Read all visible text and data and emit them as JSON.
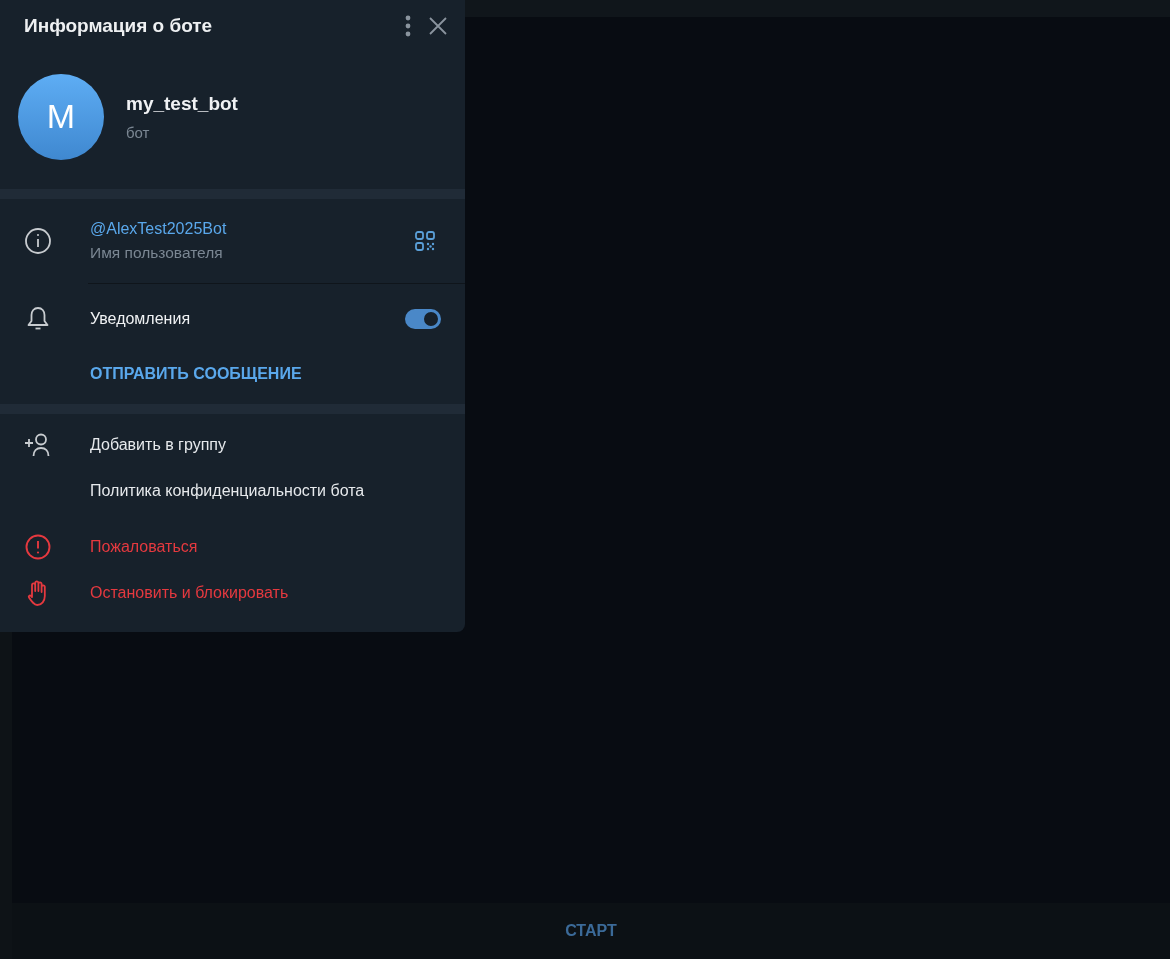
{
  "panel": {
    "title": "Информация о боте",
    "profile": {
      "avatar_letter": "M",
      "name": "my_test_bot",
      "status": "бот"
    },
    "username": {
      "value": "@AlexTest2025Bot",
      "label": "Имя пользователя"
    },
    "notifications": {
      "label": "Уведомления",
      "on": true
    },
    "send_message": "ОТПРАВИТЬ СООБЩЕНИЕ",
    "actions": [
      {
        "kind": "add-to-group",
        "label": "Добавить в группу",
        "danger": false
      },
      {
        "kind": "privacy",
        "label": "Политика конфиденциальности бота",
        "danger": false
      },
      {
        "kind": "report",
        "label": "Пожаловаться",
        "danger": true
      },
      {
        "kind": "block",
        "label": "Остановить и блокировать",
        "danger": true
      }
    ]
  },
  "chat": {
    "start_button": "СТАРТ"
  }
}
